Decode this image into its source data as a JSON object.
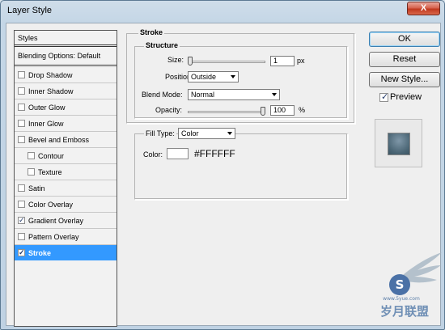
{
  "window": {
    "title": "Layer Style",
    "close_glyph": "X"
  },
  "styles_list": {
    "header": "Styles",
    "blending_options": "Blending Options: Default",
    "items": [
      {
        "label": "Drop Shadow",
        "checked": false,
        "indent": false
      },
      {
        "label": "Inner Shadow",
        "checked": false,
        "indent": false
      },
      {
        "label": "Outer Glow",
        "checked": false,
        "indent": false
      },
      {
        "label": "Inner Glow",
        "checked": false,
        "indent": false
      },
      {
        "label": "Bevel and Emboss",
        "checked": false,
        "indent": false
      },
      {
        "label": "Contour",
        "checked": false,
        "indent": true
      },
      {
        "label": "Texture",
        "checked": false,
        "indent": true
      },
      {
        "label": "Satin",
        "checked": false,
        "indent": false
      },
      {
        "label": "Color Overlay",
        "checked": false,
        "indent": false
      },
      {
        "label": "Gradient Overlay",
        "checked": true,
        "indent": false
      },
      {
        "label": "Pattern Overlay",
        "checked": false,
        "indent": false
      },
      {
        "label": "Stroke",
        "checked": true,
        "indent": false,
        "active": true
      }
    ]
  },
  "stroke": {
    "title": "Stroke",
    "structure_title": "Structure",
    "size_label": "Size:",
    "size_value": "1",
    "size_unit": "px",
    "position_label": "Position:",
    "position_value": "Outside",
    "blend_mode_label": "Blend Mode:",
    "blend_mode_value": "Normal",
    "opacity_label": "Opacity:",
    "opacity_value": "100",
    "opacity_unit": "%",
    "fill_type_label": "Fill Type:",
    "fill_type_value": "Color",
    "color_label": "Color:",
    "color_hex": "#FFFFFF",
    "color_swatch": "#ffffff",
    "size_slider_fraction": 0.0,
    "opacity_slider_fraction": 1.0
  },
  "buttons": {
    "ok": "OK",
    "reset": "Reset",
    "new_style": "New Style...",
    "preview_label": "Preview",
    "preview_checked": true
  },
  "colors": {
    "selection": "#3399ff",
    "preview_swatch": "#4a6574"
  },
  "watermark": {
    "site": "www.5yue.com",
    "brand": "岁月联盟",
    "mark": "S"
  },
  "checkbox_tick": "✓"
}
